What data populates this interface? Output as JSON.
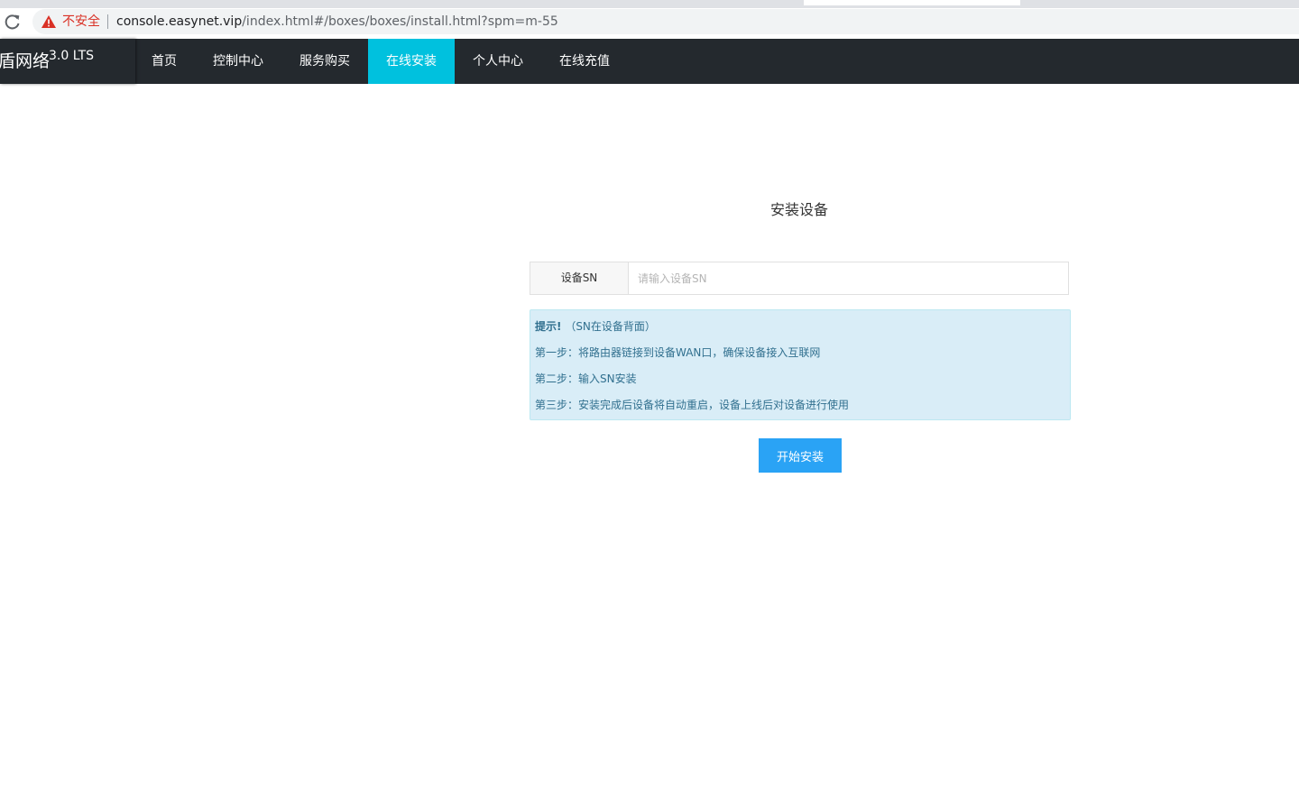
{
  "browser": {
    "security_label": "不安全",
    "url_host": "console.easynet.vip",
    "url_path": "/index.html#/boxes/boxes/install.html?spm=m-55"
  },
  "navbar": {
    "brand_name": "盾网络",
    "brand_version": "3.0 LTS",
    "items": [
      {
        "label": "首页",
        "active": false
      },
      {
        "label": "控制中心",
        "active": false
      },
      {
        "label": "服务购买",
        "active": false
      },
      {
        "label": "在线安装",
        "active": true
      },
      {
        "label": "个人中心",
        "active": false
      },
      {
        "label": "在线充值",
        "active": false
      }
    ],
    "active_color": "#00c1de",
    "background_color": "#24292e"
  },
  "main": {
    "title": "安装设备",
    "sn_label": "设备SN",
    "sn_placeholder": "请输入设备SN",
    "sn_value": "",
    "tip": {
      "heading": "提示!",
      "heading_note": "（SN在设备背面）",
      "steps": [
        "第一步：将路由器链接到设备WAN口，确保设备接入互联网",
        "第二步：输入SN安装",
        "第三步：安装完成后设备将自动重启，设备上线后对设备进行使用"
      ]
    },
    "start_button": "开始安装",
    "button_color": "#2aa3f5"
  }
}
